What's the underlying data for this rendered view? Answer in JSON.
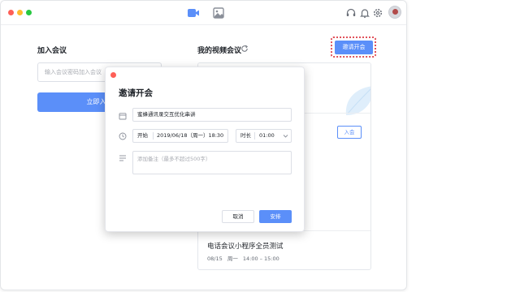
{
  "colors": {
    "accent": "#5b8ff9",
    "highlight": "#e0525b",
    "close": "#fe5f57"
  },
  "titlebar": {
    "icons": [
      "video-icon",
      "image-icon",
      "headset-icon",
      "bell-icon",
      "gear-icon",
      "avatar"
    ]
  },
  "join": {
    "title": "加入会议",
    "input_placeholder": "输入会议密码加入会议",
    "button_label": "立即入会"
  },
  "my_meetings": {
    "title": "我的视频会议",
    "invite_button": "邀请开会",
    "enter_button": "入会",
    "meetings": [
      {
        "title": "电话会议小程序全员测试",
        "date": "08/15",
        "weekday": "周一",
        "time": "14:00 – 15:00"
      }
    ]
  },
  "modal": {
    "title": "邀请开会",
    "topic": "蜜蜂通讯录交互优化串讲",
    "start_label": "开始",
    "start_value": "2019/06/18（周一）18:30",
    "duration_label": "时长",
    "duration_value": "01:00",
    "notes_placeholder": "添加备注（最多不超过500字）",
    "cancel_label": "取消",
    "confirm_label": "安排"
  }
}
